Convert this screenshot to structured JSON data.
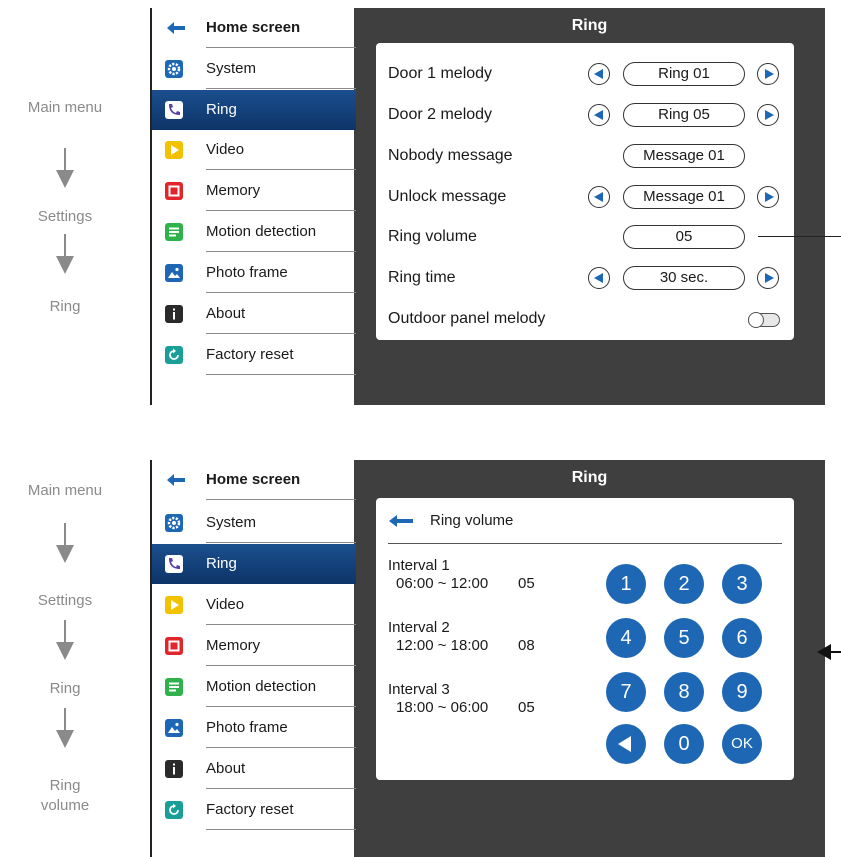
{
  "flow_top": {
    "steps": [
      "Main menu",
      "Settings",
      "Ring"
    ]
  },
  "flow_bottom": {
    "steps": [
      "Main menu",
      "Settings",
      "Ring",
      "Ring volume"
    ]
  },
  "sidebar": {
    "home": "Home screen",
    "items": [
      {
        "label": "System",
        "icon": "gear-icon",
        "color": "#1d67b4"
      },
      {
        "label": "Ring",
        "icon": "phone-icon",
        "color": "#5b3fa8"
      },
      {
        "label": "Video",
        "icon": "play-icon",
        "color": "#f2c100"
      },
      {
        "label": "Memory",
        "icon": "record-icon",
        "color": "#e0262b"
      },
      {
        "label": "Motion detection",
        "icon": "list-icon",
        "color": "#2fb24c"
      },
      {
        "label": "Photo frame",
        "icon": "landscape-icon",
        "color": "#1d67b4"
      },
      {
        "label": "About",
        "icon": "info-icon",
        "color": "#2a2a2a"
      },
      {
        "label": "Factory reset",
        "icon": "reset-icon",
        "color": "#1a9e98"
      }
    ],
    "active": "Ring"
  },
  "screen_title": "Ring",
  "ring_settings": [
    {
      "label": "Door 1 melody",
      "value": "Ring 01",
      "arrows": true
    },
    {
      "label": "Door 2 melody",
      "value": "Ring 05",
      "arrows": true
    },
    {
      "label": "Nobody message",
      "value": "Message 01",
      "arrows": false
    },
    {
      "label": "Unlock message",
      "value": "Message 01",
      "arrows": true
    },
    {
      "label": "Ring volume",
      "value": "05",
      "arrows": false
    },
    {
      "label": "Ring time",
      "value": "30 sec.",
      "arrows": true
    },
    {
      "label": "Outdoor panel melody",
      "toggle": false
    }
  ],
  "ring_volume": {
    "title": "Ring volume",
    "intervals": [
      {
        "name": "Interval 1",
        "range": "06:00 ~ 12:00",
        "value": "05"
      },
      {
        "name": "Interval 2",
        "range": "12:00 ~ 18:00",
        "value": "08"
      },
      {
        "name": "Interval 3",
        "range": "18:00 ~ 06:00",
        "value": "05"
      }
    ],
    "keypad": [
      "1",
      "2",
      "3",
      "4",
      "5",
      "6",
      "7",
      "8",
      "9",
      "back",
      "0",
      "OK"
    ]
  },
  "colors": {
    "accent": "#1d67b4",
    "screen_bg": "#3f3f3f",
    "active_item": "#0d3468"
  }
}
